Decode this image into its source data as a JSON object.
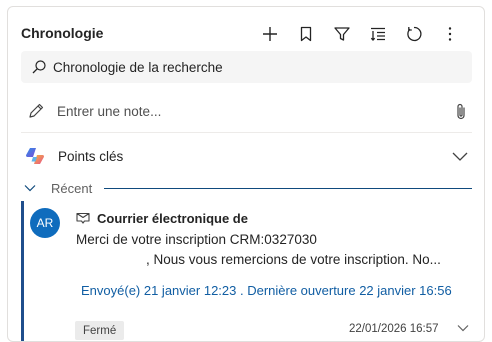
{
  "panel": {
    "title": "Chronologie",
    "toolbar": [
      {
        "name": "add-icon"
      },
      {
        "name": "bookmark-icon"
      },
      {
        "name": "filter-icon"
      },
      {
        "name": "sort-icon"
      },
      {
        "name": "refresh-icon"
      },
      {
        "name": "more-icon"
      }
    ]
  },
  "search": {
    "placeholder": "Chronologie de la recherche"
  },
  "note": {
    "placeholder": "Entrer une note..."
  },
  "keypoints": {
    "label": "Points clés"
  },
  "recent": {
    "label": "Récent"
  },
  "activity": {
    "avatar_initials": "AR",
    "type_label": "Courrier électronique de",
    "subject": "Merci de votre inscription CRM:0327030",
    "body": ", Nous vous remercions de votre inscription. No...",
    "sent_info": "Envoyé(e) 21 janvier 12:23 . Dernière ouverture 22 janvier 16:56",
    "status": "Fermé",
    "date": "22/01/2026 16:57"
  },
  "colors": {
    "accent": "#0f6cbd",
    "link": "#115ea3",
    "bar": "#1f4e8c"
  }
}
